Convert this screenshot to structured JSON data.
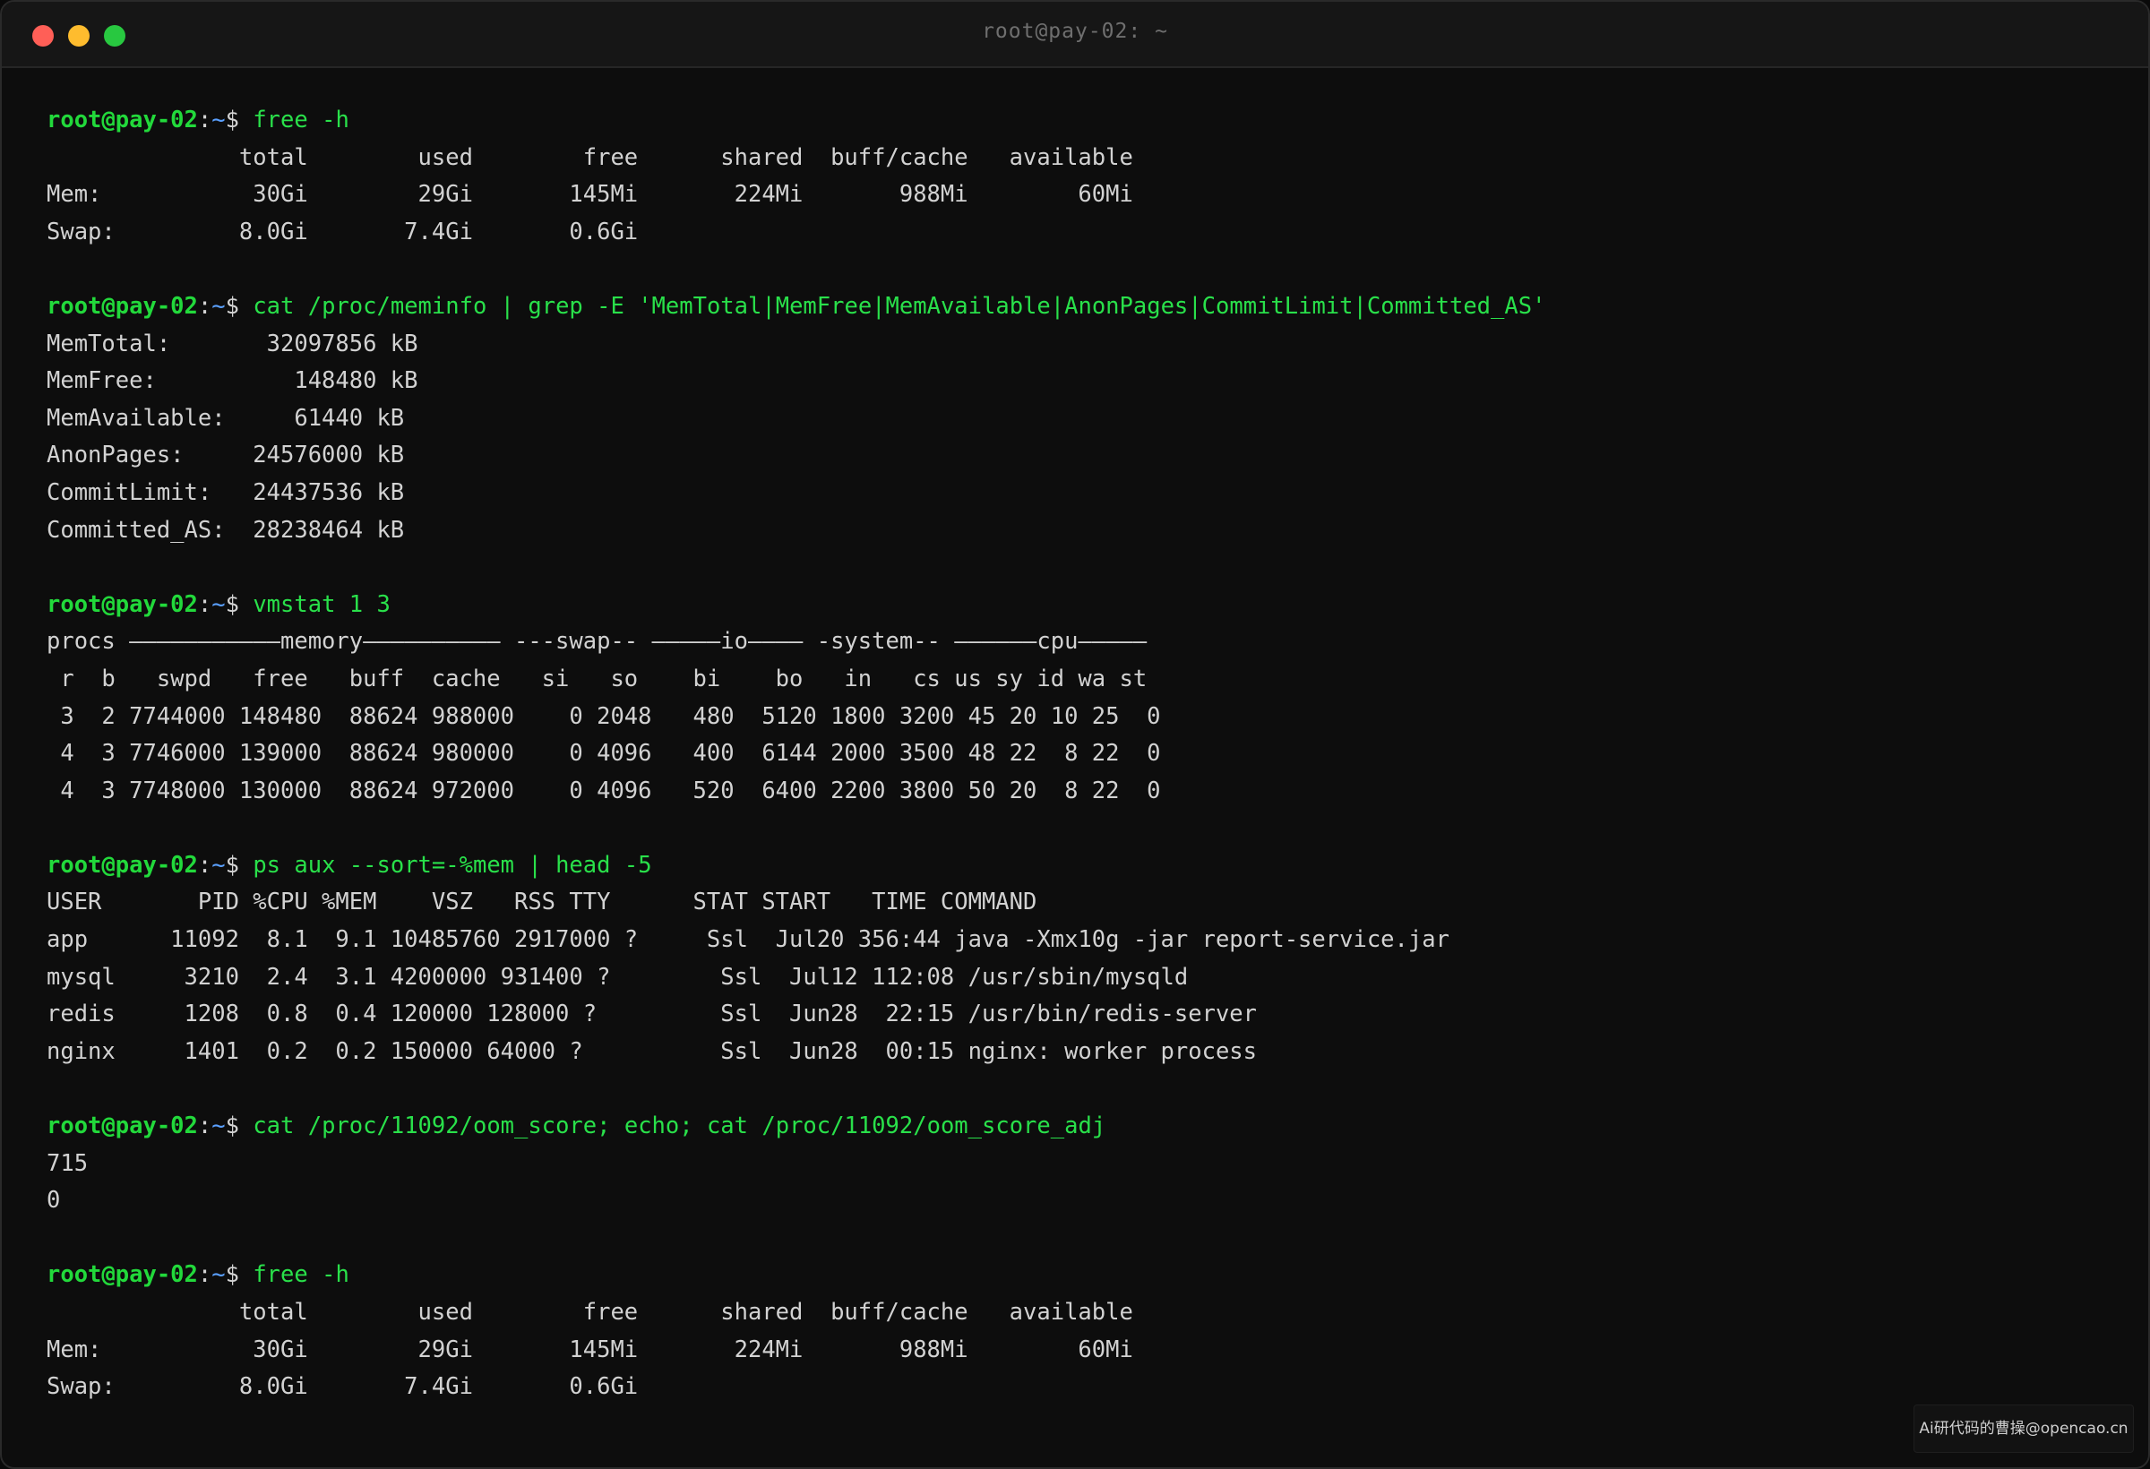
{
  "window": {
    "title": "root@pay-02: ~"
  },
  "prompt": {
    "user": "root@pay-02",
    "sep": ":",
    "path": "~",
    "sym": "$ "
  },
  "blocks": [
    {
      "command": "free -h",
      "output": [
        "              total        used        free      shared  buff/cache   available",
        "Mem:           30Gi        29Gi       145Mi       224Mi       988Mi        60Mi",
        "Swap:         8.0Gi       7.4Gi       0.6Gi"
      ]
    },
    {
      "command": "cat /proc/meminfo | grep -E 'MemTotal|MemFree|MemAvailable|AnonPages|CommitLimit|Committed_AS'",
      "output": [
        "MemTotal:       32097856 kB",
        "MemFree:          148480 kB",
        "MemAvailable:     61440 kB",
        "AnonPages:     24576000 kB",
        "CommitLimit:   24437536 kB",
        "Committed_AS:  28238464 kB"
      ]
    },
    {
      "command": "vmstat 1 3",
      "output": [
        "procs ———————————memory—————————— ---swap-- —————io———— -system-- ——————cpu—————",
        " r  b   swpd   free   buff  cache   si   so    bi    bo   in   cs us sy id wa st",
        " 3  2 7744000 148480  88624 988000    0 2048   480  5120 1800 3200 45 20 10 25  0",
        " 4  3 7746000 139000  88624 980000    0 4096   400  6144 2000 3500 48 22  8 22  0",
        " 4  3 7748000 130000  88624 972000    0 4096   520  6400 2200 3800 50 20  8 22  0"
      ]
    },
    {
      "command": "ps aux --sort=-%mem | head -5",
      "output": [
        "USER       PID %CPU %MEM    VSZ   RSS TTY      STAT START   TIME COMMAND",
        "app      11092  8.1  9.1 10485760 2917000 ?     Ssl  Jul20 356:44 java -Xmx10g -jar report-service.jar",
        "mysql     3210  2.4  3.1 4200000 931400 ?        Ssl  Jul12 112:08 /usr/sbin/mysqld",
        "redis     1208  0.8  0.4 120000 128000 ?         Ssl  Jun28  22:15 /usr/bin/redis-server",
        "nginx     1401  0.2  0.2 150000 64000 ?          Ssl  Jun28  00:15 nginx: worker process"
      ]
    },
    {
      "command": "cat /proc/11092/oom_score; echo; cat /proc/11092/oom_score_adj",
      "output": [
        "715",
        "0"
      ]
    },
    {
      "command": "free -h",
      "output": [
        "              total        used        free      shared  buff/cache   available",
        "Mem:           30Gi        29Gi       145Mi       224Mi       988Mi        60Mi",
        "Swap:         8.0Gi       7.4Gi       0.6Gi"
      ]
    }
  ],
  "watermark": {
    "text": "Ai研代码的曹操@opencao.cn"
  },
  "colors": {
    "prompt_user": "#22d93b",
    "prompt_path": "#5aa0ff",
    "command": "#29e04a",
    "output": "#d2d2d2",
    "background": "#0d0d0d"
  }
}
